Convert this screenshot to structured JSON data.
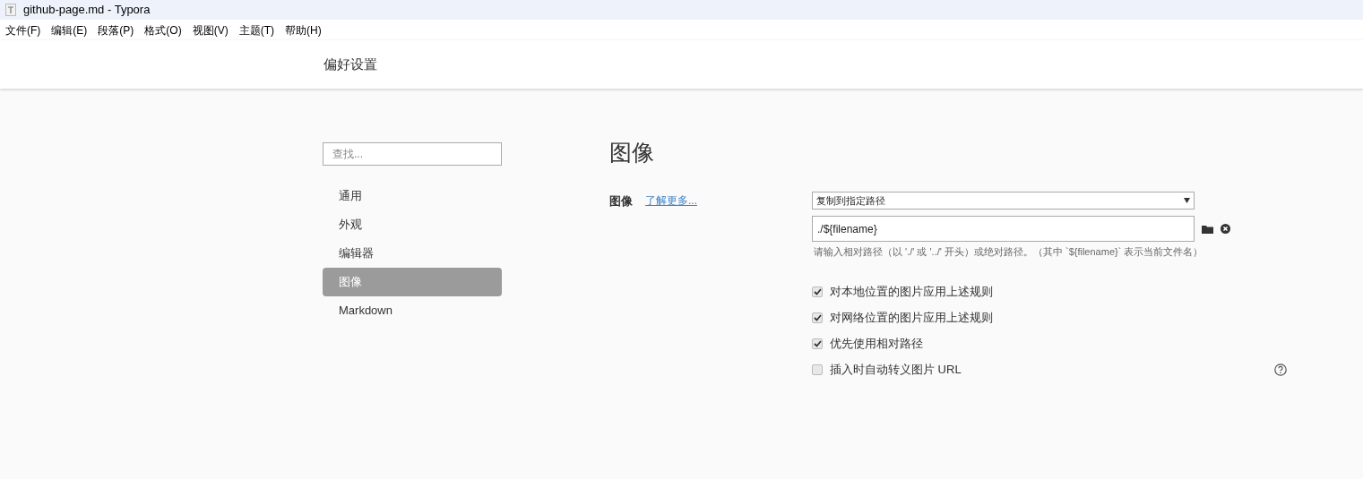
{
  "window": {
    "title": "github-page.md - Typora"
  },
  "menu": [
    "文件(F)",
    "编辑(E)",
    "段落(P)",
    "格式(O)",
    "视图(V)",
    "主题(T)",
    "帮助(H)"
  ],
  "header": {
    "title": "偏好设置"
  },
  "sidebar": {
    "search": {
      "placeholder": "查找..."
    },
    "items": [
      {
        "label": "通用",
        "selected": false
      },
      {
        "label": "外观",
        "selected": false
      },
      {
        "label": "编辑器",
        "selected": false
      },
      {
        "label": "图像",
        "selected": true
      },
      {
        "label": "Markdown",
        "selected": false
      }
    ]
  },
  "content": {
    "heading": "图像",
    "label": "图像",
    "link": "了解更多...",
    "select": {
      "value": "复制到指定路径"
    },
    "path": {
      "value": "./${filename}"
    },
    "hint": "请输入相对路径（以 './' 或 '../' 开头）或绝对路径。（其中 `${filename}` 表示当前文件名）",
    "options": [
      {
        "label": "对本地位置的图片应用上述规则",
        "checked": true
      },
      {
        "label": "对网络位置的图片应用上述规则",
        "checked": true
      },
      {
        "label": "优先使用相对路径",
        "checked": true
      },
      {
        "label": "插入时自动转义图片 URL",
        "checked": false
      }
    ]
  }
}
